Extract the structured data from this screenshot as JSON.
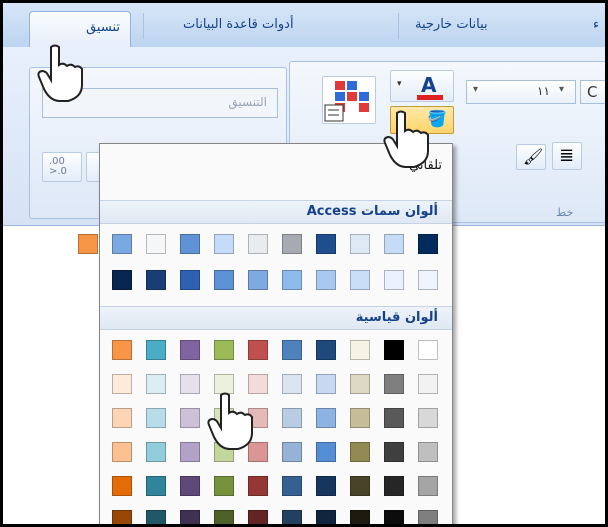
{
  "tabs": [
    {
      "label": "تنسيق",
      "active": true
    },
    {
      "label": "أدوات قاعدة البيانات",
      "active": false
    },
    {
      "label": "بيانات خارجية",
      "active": false
    },
    {
      "label": "ء",
      "active": false
    }
  ],
  "ribbon": {
    "format_box_placeholder": "التنسيق",
    "font_size_value": "١١",
    "font_name_partial": "C",
    "font_group_label": "خط",
    "font_color_letter": "A",
    "decimal_button_label": ".00\n.0"
  },
  "color_menu": {
    "automatic_label": "تلقائي",
    "theme_header": "ألوان سمات Access",
    "standard_header": "ألوان قياسية",
    "theme_colors": [
      [
        "#002b5c",
        "#c6dcf6",
        "#dfe9f5",
        "#1f4e8c",
        "#a7aab0",
        "#e9ecef",
        "#c4dcfa",
        "#5f93d8",
        "#f4f6f8",
        "#7aa8e0",
        "#f79646"
      ],
      [
        "#eef5fd",
        "#e8f1fc",
        "#c9def7",
        "#a7c9f1",
        "#8fbaed",
        "#7ea9e2",
        "#5e92d6",
        "#2e62b0",
        "#1a3d75",
        "#062650"
      ]
    ],
    "standard_colors": [
      [
        "#ffffff",
        "#000000",
        "#f7f3e4",
        "#1f497d",
        "#4f81bd",
        "#c0504d",
        "#9bbb59",
        "#8064a2",
        "#4bacc6",
        "#f79646"
      ],
      [
        "#f2f2f2",
        "#7f7f7f",
        "#ddd9c3",
        "#c6d9f0",
        "#dbe5f1",
        "#f2dcdb",
        "#ebf1dd",
        "#e5e0ec",
        "#dbeef3",
        "#fdeada"
      ],
      [
        "#d8d8d8",
        "#595959",
        "#c4bd97",
        "#8db3e2",
        "#b8cce4",
        "#e5b9b7",
        "#d7e3bc",
        "#ccc1d9",
        "#b7dde8",
        "#fbd5b5"
      ],
      [
        "#bfbfbf",
        "#3f3f3f",
        "#938953",
        "#548dd4",
        "#95b3d7",
        "#d99694",
        "#c3d69b",
        "#b2a2c7",
        "#92cddc",
        "#fac08f"
      ],
      [
        "#a5a5a5",
        "#262626",
        "#494429",
        "#17365d",
        "#366092",
        "#953734",
        "#76923c",
        "#5f497a",
        "#31859b",
        "#e36c09"
      ],
      [
        "#7f7f7f",
        "#0c0c0c",
        "#1d1b10",
        "#0f243e",
        "#244061",
        "#632423",
        "#4f6128",
        "#3f3151",
        "#205867",
        "#974806"
      ]
    ]
  },
  "icons": [
    "hand-pointer-icon",
    "font-color-icon",
    "fill-color-icon",
    "format-painter-icon",
    "align-icon",
    "gridlines-icon",
    "alternate-fill-icon",
    "dropdown-arrow-icon"
  ]
}
